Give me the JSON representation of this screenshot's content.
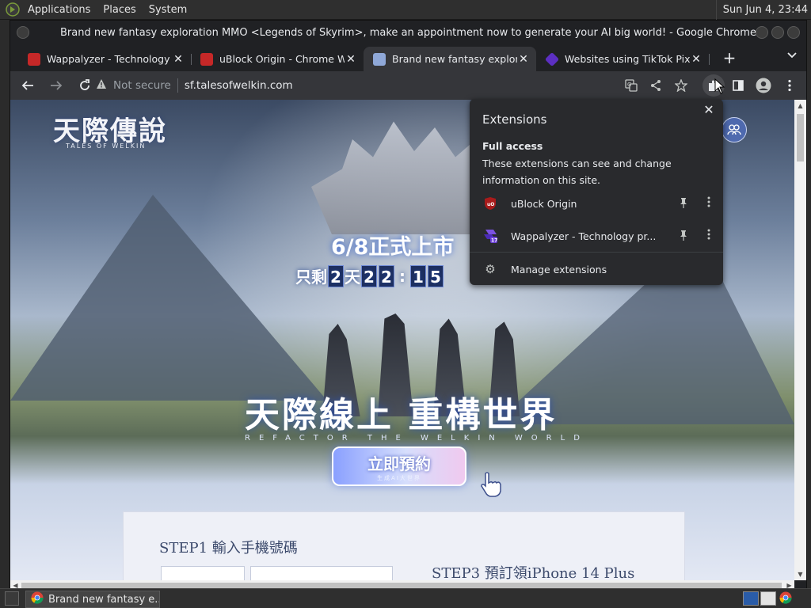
{
  "top_panel": {
    "menus": [
      "Applications",
      "Places",
      "System"
    ],
    "clock": "Sun Jun  4, 23:44"
  },
  "window": {
    "title": "Brand new fantasy exploration MMO <Legends of Skyrim>, make an appointment now to generate your AI big world! - Google Chrome"
  },
  "tabs": [
    {
      "label": "Wappalyzer - Technology p",
      "active": false,
      "favicon_color": "#c62828"
    },
    {
      "label": "uBlock Origin - Chrome We",
      "active": false,
      "favicon_color": "#c62828"
    },
    {
      "label": "Brand new fantasy explora",
      "active": true,
      "favicon_color": "#8fa8d8"
    },
    {
      "label": "Websites using TikTok Pixe",
      "active": false,
      "favicon_color": "#5c2fc2"
    }
  ],
  "toolbar": {
    "not_secure": "Not secure",
    "url": "sf.talesofwelkin.com"
  },
  "page": {
    "brand": "天際傳說",
    "brand_sub": "TALES OF WELKIN",
    "release": "6/8正式上市",
    "countdown_prefix": "只剩",
    "countdown_days": "2",
    "countdown_day_unit": "天",
    "countdown_hours": [
      "2",
      "2"
    ],
    "countdown_sep": ":",
    "countdown_minutes": [
      "1",
      "5"
    ],
    "slogan": "天際線上 重構世界",
    "slogan_sub": "REFACTOR THE WELKIN WORLD",
    "reserve_button": "立即預約",
    "reserve_sub": "生成AI大世界",
    "step1": "STEP1  輸入手機號碼",
    "step3": "STEP3  預訂領iPhone 14 Plus"
  },
  "extensions_popup": {
    "heading": "Extensions",
    "section": "Full access",
    "description": "These extensions can see and change information on this site.",
    "items": [
      {
        "name": "uBlock Origin",
        "icon": "uBlock",
        "color": "#a81b1b"
      },
      {
        "name": "Wappalyzer - Technology pr...",
        "icon": "17",
        "color": "#4b2bb8"
      }
    ],
    "manage": "Manage extensions"
  },
  "taskbar": {
    "task_label": "Brand new fantasy e..."
  }
}
